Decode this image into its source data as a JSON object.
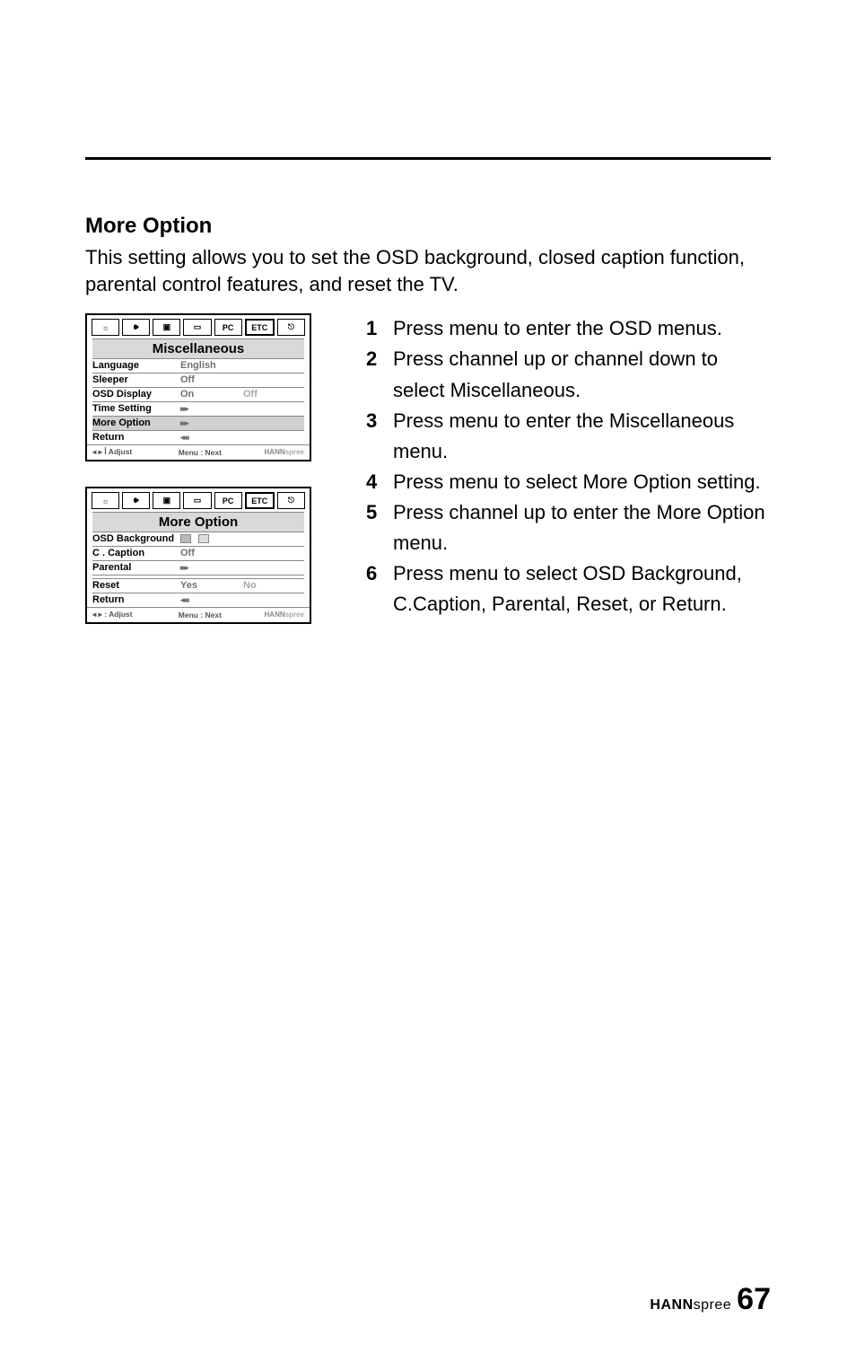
{
  "heading": "More Option",
  "intro": "This setting allows you to set the OSD background, closed caption function, parental control features, and reset the TV.",
  "steps": [
    "Press menu to enter the OSD menus.",
    "Press channel up or channel down to select Miscellaneous.",
    "Press menu to enter the Miscellaneous menu.",
    "Press menu to select More Option setting.",
    "Press channel up to enter the More Option menu.",
    "Press menu to select OSD Background, C.Caption, Parental, Reset, or Return."
  ],
  "panel1": {
    "tabs_pc": "PC",
    "title": "Miscellaneous",
    "rows": [
      {
        "label": "Language",
        "v1": "English",
        "v2": ""
      },
      {
        "label": "Sleeper",
        "v1": "Off",
        "v2": ""
      },
      {
        "label": "OSD Display",
        "v1": "On",
        "v2": "Off"
      },
      {
        "label": "Time Setting",
        "v1": "▸▸▸",
        "v2": "",
        "arrow": true
      },
      {
        "label": "More Option",
        "v1": "▸▸▸",
        "v2": "",
        "highlight": true,
        "arrow": true
      },
      {
        "label": "Return",
        "v1": "◂◂◂",
        "v2": "",
        "arrow": true
      }
    ],
    "footer_left": "◂ ▸  ꟾ Adjust",
    "footer_mid": "Menu  :  Next",
    "footer_brand1": "HANN",
    "footer_brand2": "spree"
  },
  "panel2": {
    "tabs_pc": "PC",
    "title": "More Option",
    "rows": [
      {
        "label": "OSD Background",
        "v1": "☐",
        "v2": "☐",
        "boxes": true
      },
      {
        "label": "C . Caption",
        "v1": "Off",
        "v2": ""
      },
      {
        "label": "Parental",
        "v1": "▸▸▸",
        "v2": "",
        "arrow": true
      },
      {
        "label": "",
        "v1": "",
        "v2": ""
      },
      {
        "label": "Reset",
        "v1": "Yes",
        "v2": "No"
      },
      {
        "label": "Return",
        "v1": "◂◂◂",
        "v2": "",
        "arrow": true
      }
    ],
    "footer_left": "◂ ▸  :  Adjust",
    "footer_mid": "Menu  :  Next",
    "footer_brand1": "HANN",
    "footer_brand2": "spree"
  },
  "page": {
    "brand1": "HANN",
    "brand2": "spree",
    "number": "67"
  }
}
